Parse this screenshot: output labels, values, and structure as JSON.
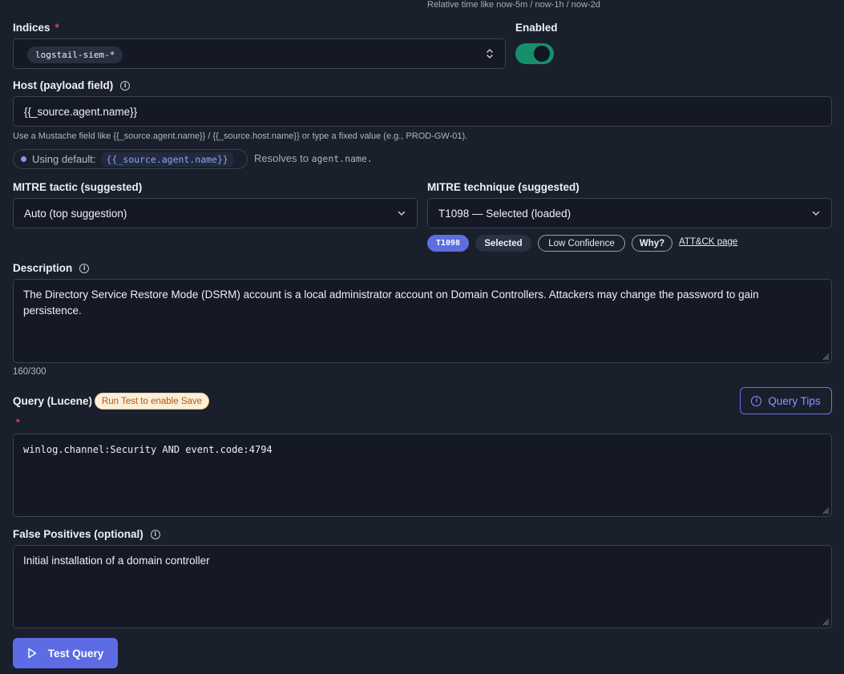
{
  "top_hint": "Relative time like now-5m / now-1h / now-2d",
  "indices": {
    "label": "Indices",
    "required_mark": "*",
    "selected_chip": "logstail-siem-*"
  },
  "enabled": {
    "label": "Enabled",
    "state": true,
    "accent": "#16906a"
  },
  "host": {
    "label": "Host (payload field)",
    "value": "{{_source.agent.name}}",
    "help": "Use a Mustache field like {{_source.agent.name}} / {{_source.host.name}} or type a fixed value (e.g., PROD-GW-01).",
    "default_prefix": "Using default:",
    "default_value": "{{_source.agent.name}}",
    "resolves_prefix": "Resolves to",
    "resolves_value": "agent.name."
  },
  "mitre_tactic": {
    "label": "MITRE tactic (suggested)",
    "value": "Auto (top suggestion)"
  },
  "mitre_technique": {
    "label": "MITRE technique (suggested)",
    "value": "T1098 — Selected (loaded)",
    "badges": {
      "id": "T1098",
      "selected": "Selected",
      "confidence": "Low Confidence",
      "why": "Why?",
      "link": "ATT&CK page"
    }
  },
  "description": {
    "label": "Description",
    "value": "The Directory Service Restore Mode (DSRM) account is a local administrator account on Domain Controllers. Attackers may change the password to gain persistence.",
    "counter": "160/300"
  },
  "query": {
    "label": "Query (Lucene)",
    "warning": "Run Test to enable Save",
    "required_mark": "*",
    "value": "winlog.channel:Security AND event.code:4794",
    "tips_button": "Query Tips"
  },
  "false_positives": {
    "label": "False Positives (optional)",
    "value": "Initial installation of a domain controller"
  },
  "test_button": "Test Query",
  "colors": {
    "background": "#1a1f2c",
    "primary": "#5d6be5",
    "required": "#e5484d",
    "warning_text": "#b4560c"
  }
}
